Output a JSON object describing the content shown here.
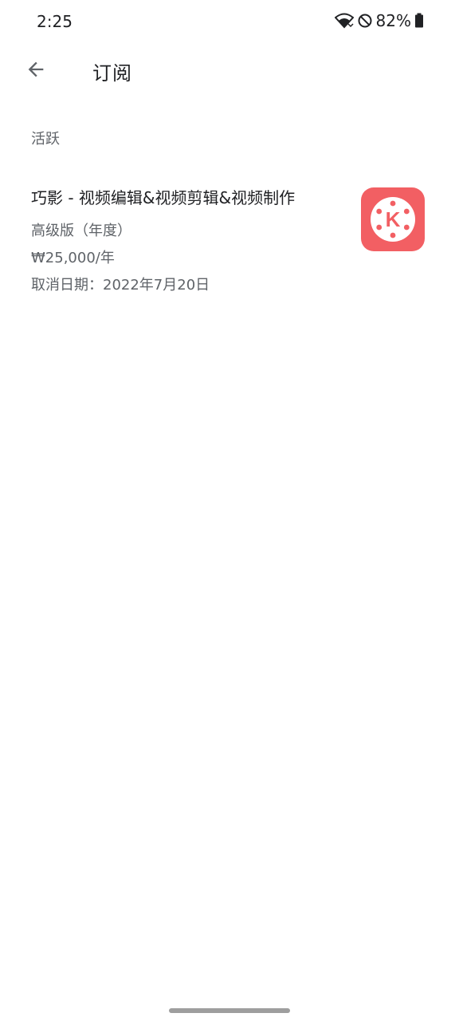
{
  "status_bar": {
    "time": "2:25",
    "battery": "82%"
  },
  "app_bar": {
    "title": "订阅"
  },
  "section": {
    "header": "活跃"
  },
  "subscription": {
    "app_name": "巧影 - 视频编辑&视频剪辑&视频制作",
    "plan": "高级版（年度）",
    "price": "₩25,000/年",
    "cancel_date": "取消日期：2022年7月20日",
    "icon_letter": "K",
    "icon_color": "#f25f63"
  }
}
